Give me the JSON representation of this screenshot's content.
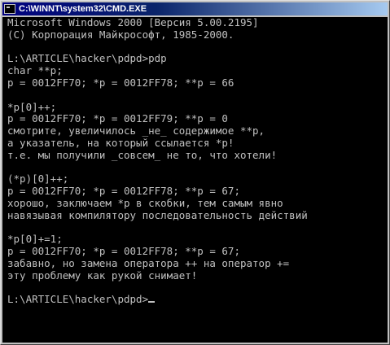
{
  "window": {
    "title": "C:\\WINNT\\system32\\CMD.EXE",
    "icon": "cmd-icon"
  },
  "console": {
    "lines": [
      "Microsoft Windows 2000 [Версия 5.00.2195]",
      "(C) Корпорация Майкрософт, 1985-2000.",
      "",
      "L:\\ARTICLE\\hacker\\pdpd>pdp",
      "char **p;",
      "p = 0012FF70; *p = 0012FF78; **p = 66",
      "",
      "*p[0]++;",
      "p = 0012FF70; *p = 0012FF79; **p = 0",
      "смотрите, увеличилось _не_ содержимое **p,",
      "а указатель, на который ссылается *p!",
      "т.е. мы получили _совсем_ не то, что хотели!",
      "",
      "(*p)[0]++;",
      "p = 0012FF70; *p = 0012FF78; **p = 67;",
      "хорошо, заключаем *p в скобки, тем самым явно",
      "навязывая компилятору последовательность действий",
      "",
      "*p[0]+=1;",
      "p = 0012FF70; *p = 0012FF78; **p = 67;",
      "забавно, но замена оператора ++ на оператор +=",
      "эту проблему как рукой снимает!",
      "",
      "L:\\ARTICLE\\hacker\\pdpd>"
    ]
  },
  "colors": {
    "console_bg": "#000000",
    "console_fg": "#c0c0c0",
    "title_start": "#000080",
    "title_end": "#a6caf0"
  }
}
